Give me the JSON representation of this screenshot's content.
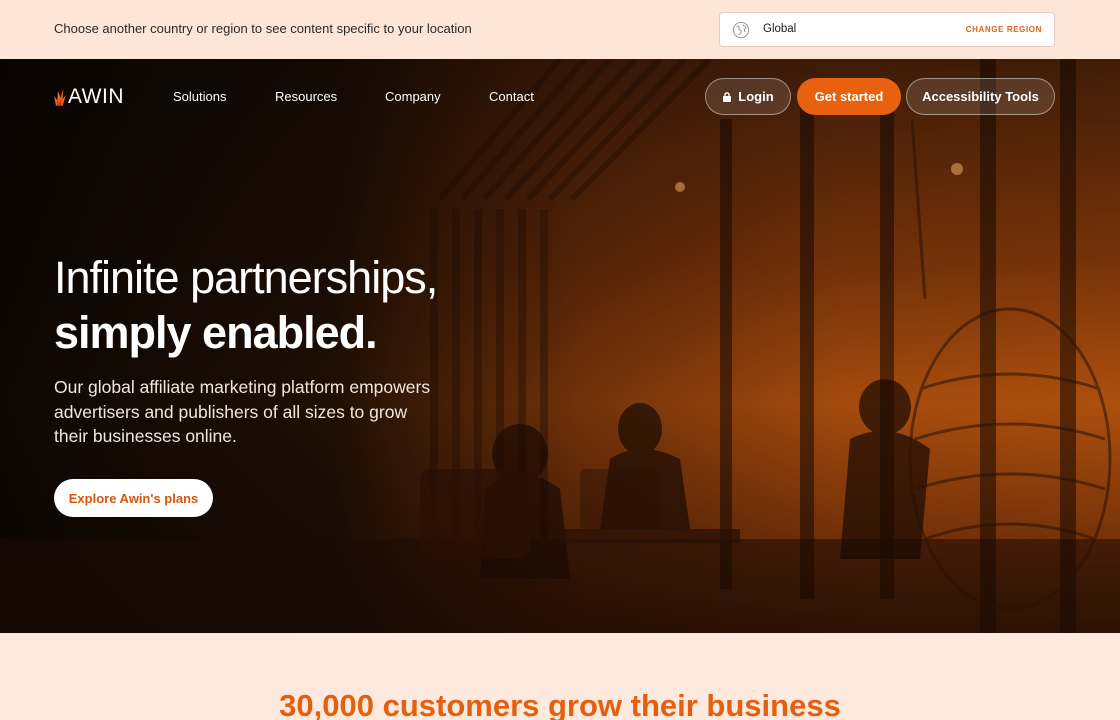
{
  "region_bar": {
    "message": "Choose another country or region to see content specific to your location",
    "selected_region": "Global",
    "change_label": "CHANGE REGION"
  },
  "nav": {
    "logo_text": "AWIN",
    "links": [
      "Solutions",
      "Resources",
      "Company",
      "Contact"
    ],
    "login_label": "Login",
    "get_started_label": "Get started",
    "accessibility_label": "Accessibility Tools"
  },
  "hero": {
    "headline_line1": "Infinite partnerships,",
    "headline_line2": "simply enabled.",
    "subcopy": "Our global affiliate marketing platform empowers advertisers and publishers of all sizes to grow their businesses online.",
    "cta_label": "Explore Awin's plans"
  },
  "section": {
    "heading": "30,000 customers grow their business"
  },
  "colors": {
    "accent": "#e8610f",
    "region_bar_bg": "#fde6d8",
    "page_bg": "#fde9dd"
  },
  "icons": [
    "globe-icon",
    "lock-icon",
    "awin-logo-flame"
  ]
}
